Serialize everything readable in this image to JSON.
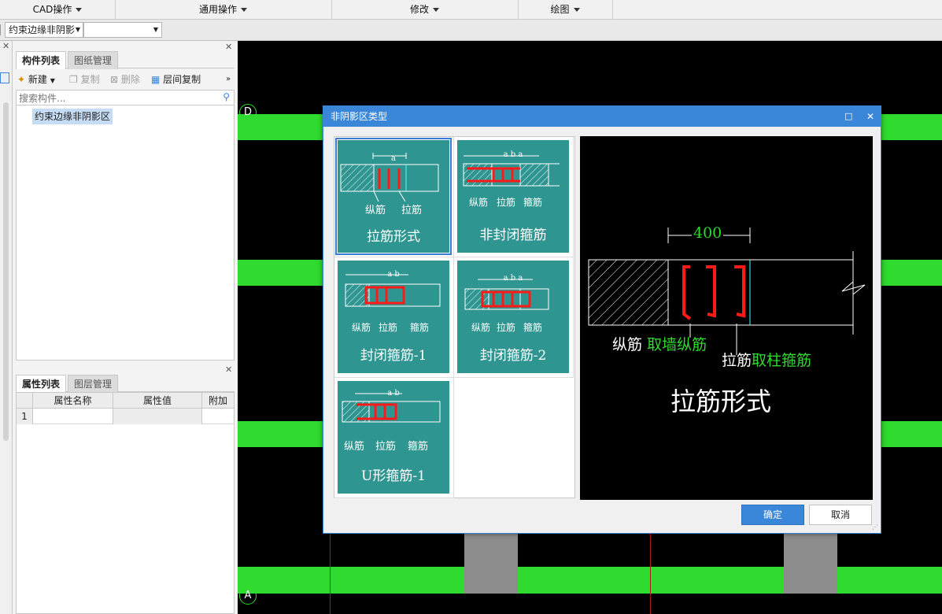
{
  "menubar": {
    "items": [
      "CAD操作",
      "通用操作",
      "修改",
      "绘图"
    ]
  },
  "toolbar2": {
    "component_combo": "约束边缘非阴影",
    "second_combo": ""
  },
  "component_panel": {
    "tabs": [
      "构件列表",
      "图纸管理"
    ],
    "buttons": {
      "new": "新建",
      "copy": "复制",
      "delete": "删除",
      "floor_copy": "层间复制"
    },
    "search_placeholder": "搜索构件...",
    "items": [
      "约束边缘非阴影区"
    ]
  },
  "property_panel": {
    "tabs": [
      "属性列表",
      "图层管理"
    ],
    "columns": [
      "属性名称",
      "属性值",
      "附加"
    ],
    "rows": [
      {
        "index": "1",
        "name": "",
        "value": "",
        "extra": ""
      }
    ]
  },
  "cad": {
    "axis_labels": [
      "D",
      "A"
    ]
  },
  "dialog": {
    "title": "非阴影区类型",
    "options": [
      {
        "title": "拉筋形式",
        "labels": [
          "纵筋",
          "拉筋"
        ],
        "dims": "a",
        "selected": true
      },
      {
        "title": "非封闭箍筋",
        "labels": [
          "纵筋",
          "拉筋",
          "箍筋"
        ],
        "dims": "a b a"
      },
      {
        "title": "封闭箍筋-1",
        "labels": [
          "纵筋",
          "拉筋",
          "箍筋"
        ],
        "dims": "a b"
      },
      {
        "title": "封闭箍筋-2",
        "labels": [
          "纵筋",
          "拉筋",
          "箍筋"
        ],
        "dims": "a b a"
      },
      {
        "title": "U形箍筋-1",
        "labels": [
          "纵筋",
          "拉筋",
          "箍筋"
        ],
        "dims": "a b"
      }
    ],
    "preview": {
      "dimension": "400",
      "label1_white": "纵筋",
      "label1_green": "取墙纵筋",
      "label2_white": "拉筋",
      "label2_green": "取柱箍筋",
      "title": "拉筋形式"
    },
    "ok": "确定",
    "cancel": "取消"
  },
  "colors": {
    "accent": "#3a86d8",
    "card": "#2f9590",
    "cad_green": "#2edb2e",
    "rebar_red": "#ff1a1a"
  }
}
